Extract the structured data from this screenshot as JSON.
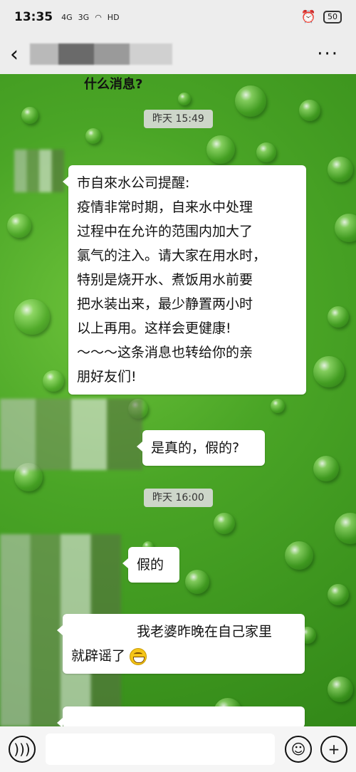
{
  "status_bar": {
    "time": "13:35",
    "signal_1": "4G",
    "signal_2": "3G",
    "network": "HD",
    "battery": "50"
  },
  "header": {
    "back_label": "‹",
    "more_label": "···"
  },
  "messages": {
    "partial_top": "什么消息?",
    "timestamp_1": "昨天 15:49",
    "incoming_long": [
      "市自來水公司提醒:",
      "疫情非常时期，自来水中处理",
      "过程中在允许的范围内加大了",
      "氯气的注入。请大家在用水时，",
      "特别是烧开水、煮饭用水前要",
      "把水装出来，最少静置两小时",
      "以上再用。这样会更健康!",
      "～～～这条消息也转给你的亲",
      "朋好友们!"
    ],
    "question": "是真的，假的?",
    "timestamp_2": "昨天 16:00",
    "reply_fake": "假的",
    "reply_wife_line1": "我老婆昨晚在自己家里",
    "reply_wife_line2": "就辟谣了"
  },
  "input_bar": {
    "placeholder": ""
  }
}
